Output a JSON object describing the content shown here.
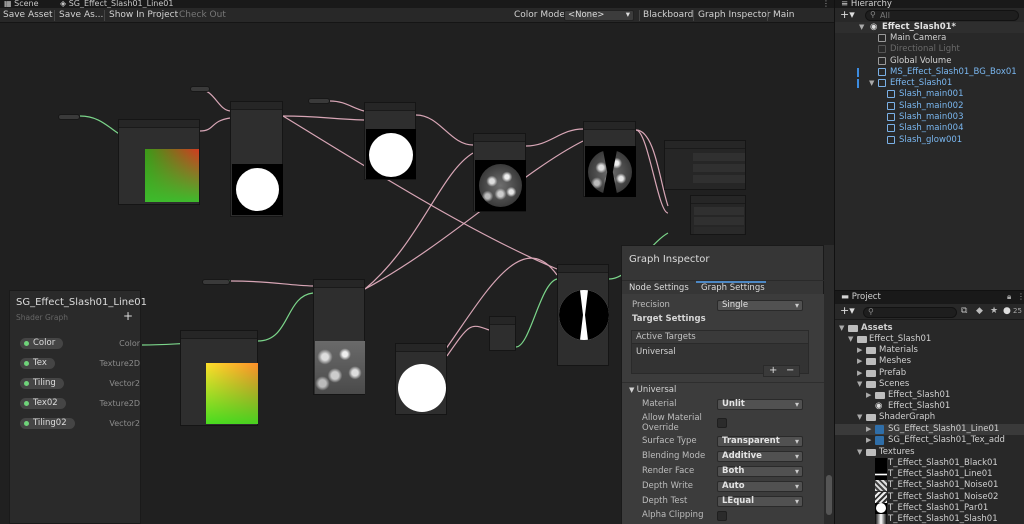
{
  "tabs": {
    "scene": "Scene",
    "shadergraph": "SG_Effect_Slash01_Line01",
    "hierarchy": "Hierarchy",
    "project": "Project"
  },
  "toolbar": {
    "save_asset": "Save Asset",
    "save_as": "Save As...",
    "show_in_project": "Show In Project",
    "check_out": "Check Out",
    "color_mode_label": "Color Mode",
    "color_mode_value": "<None>",
    "blackboard": "Blackboard",
    "graph_inspector": "Graph Inspector",
    "main_preview": "Main Preview"
  },
  "blackboard": {
    "title": "SG_Effect_Slash01_Line01",
    "subtitle": "Shader Graph",
    "properties": [
      {
        "name": "Color",
        "type": "Color"
      },
      {
        "name": "Tex",
        "type": "Texture2D"
      },
      {
        "name": "Tiling",
        "type": "Vector2"
      },
      {
        "name": "Tex02",
        "type": "Texture2D"
      },
      {
        "name": "Tiling02",
        "type": "Vector2"
      }
    ]
  },
  "inspector": {
    "title": "Graph Inspector",
    "tab_node": "Node Settings",
    "tab_graph": "Graph Settings",
    "precision_label": "Precision",
    "precision_value": "Single",
    "target_settings": "Target Settings",
    "active_targets": "Active Targets",
    "active_target_item": "Universal",
    "universal_section": "Universal",
    "rows": [
      {
        "label": "Material",
        "value": "Unlit"
      },
      {
        "label": "Allow Material Override",
        "value": ""
      },
      {
        "label": "Surface Type",
        "value": "Transparent"
      },
      {
        "label": "Blending Mode",
        "value": "Additive"
      },
      {
        "label": "Render Face",
        "value": "Both"
      },
      {
        "label": "Depth Write",
        "value": "Auto"
      },
      {
        "label": "Depth Test",
        "value": "LEqual"
      },
      {
        "label": "Alpha Clipping",
        "value": ""
      }
    ]
  },
  "hierarchy": {
    "search_placeholder": "All",
    "items": [
      {
        "label": "Effect_Slash01*"
      },
      {
        "label": "Main Camera"
      },
      {
        "label": "Directional Light"
      },
      {
        "label": "Global Volume"
      },
      {
        "label": "MS_Effect_Slash01_BG_Box01"
      },
      {
        "label": "Effect_Slash01"
      },
      {
        "label": "Slash_main001"
      },
      {
        "label": "Slash_main002"
      },
      {
        "label": "Slash_main003"
      },
      {
        "label": "Slash_main004"
      },
      {
        "label": "Slash_glow001"
      }
    ]
  },
  "project": {
    "badge_count": "25",
    "items": [
      {
        "label": "Assets"
      },
      {
        "label": "Effect_Slash01"
      },
      {
        "label": "Materials"
      },
      {
        "label": "Meshes"
      },
      {
        "label": "Prefab"
      },
      {
        "label": "Scenes"
      },
      {
        "label": "Effect_Slash01"
      },
      {
        "label": "Effect_Slash01"
      },
      {
        "label": "ShaderGraph"
      },
      {
        "label": "SG_Effect_Slash01_Line01"
      },
      {
        "label": "SG_Effect_Slash01_Tex_add"
      },
      {
        "label": "Textures"
      },
      {
        "label": "T_Effect_Slash01_Black01"
      },
      {
        "label": "T_Effect_Slash01_Line01"
      },
      {
        "label": "T_Effect_Slash01_Noise01"
      },
      {
        "label": "T_Effect_Slash01_Noise02"
      },
      {
        "label": "T_Effect_Slash01_Par01"
      },
      {
        "label": "T_Effect_Slash01_Slash01"
      }
    ]
  },
  "colors": {
    "accent": "#2c5d87",
    "selection": "#2c5d87",
    "prefab_blue": "#7ab7f0",
    "wire_green": "#7bd58a",
    "wire_pink": "#d8a6b6"
  }
}
